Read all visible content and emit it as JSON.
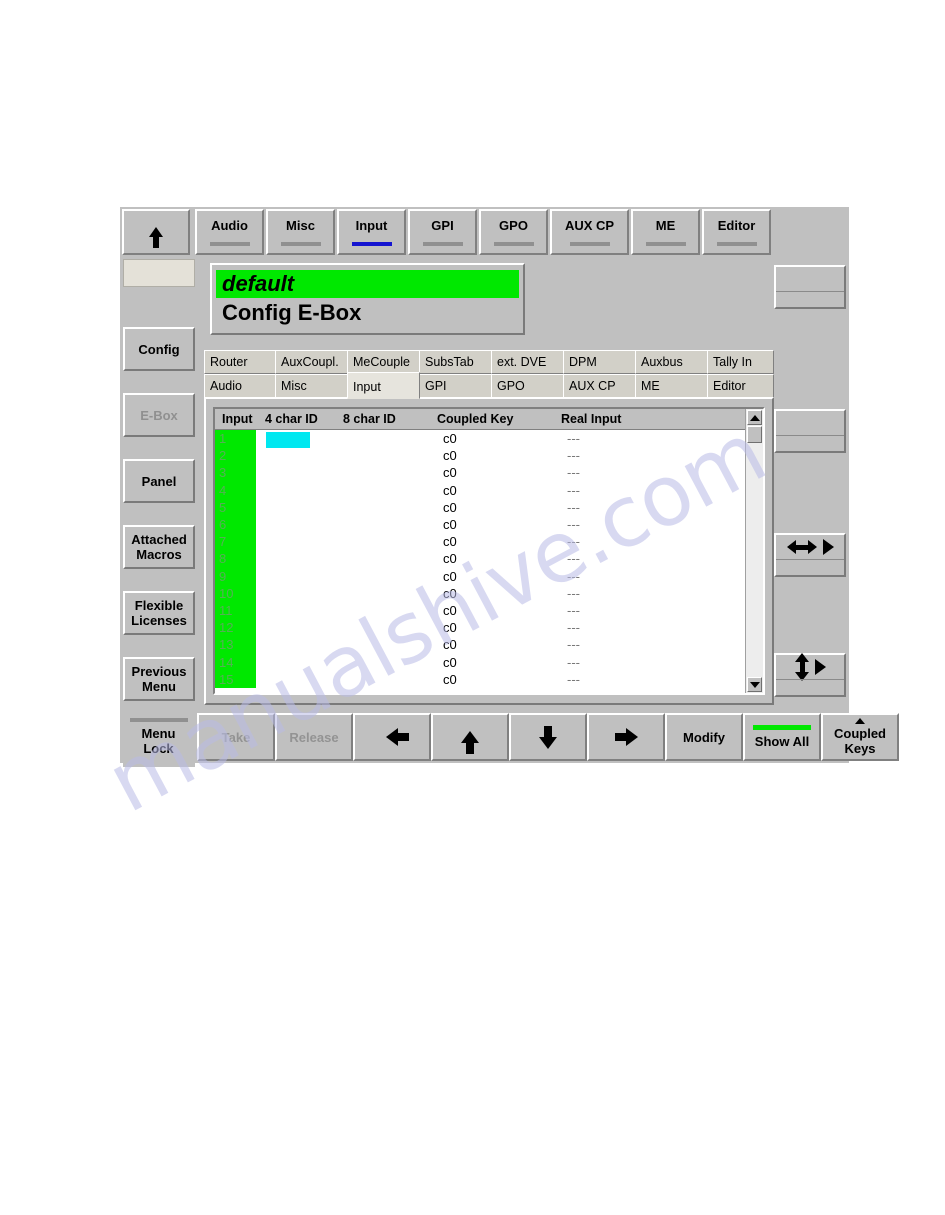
{
  "watermark": {
    "text": "manualshive.com"
  },
  "colors": {
    "panel_face": "#c0c0c0",
    "green": "#00e800",
    "cyan": "#00e8f0",
    "blue_underline": "#1414d0",
    "disabled_text": "#939393"
  },
  "topbar": {
    "back_icon": "arrow-up-icon",
    "tabs": [
      {
        "label": "Audio",
        "selected": false
      },
      {
        "label": "Misc",
        "selected": false
      },
      {
        "label": "Input",
        "selected": true
      },
      {
        "label": "GPI",
        "selected": false
      },
      {
        "label": "GPO",
        "selected": false
      },
      {
        "label": "AUX CP",
        "selected": false
      },
      {
        "label": "ME",
        "selected": false
      },
      {
        "label": "Editor",
        "selected": false
      }
    ]
  },
  "sidebar": {
    "items": [
      {
        "label": "Config",
        "disabled": false
      },
      {
        "label": "E-Box",
        "disabled": true
      },
      {
        "label": "Panel",
        "disabled": false
      },
      {
        "label": "Attached Macros",
        "disabled": false
      },
      {
        "label": "Flexible Licenses",
        "disabled": false
      },
      {
        "label": "Previous Menu",
        "disabled": false
      },
      {
        "label": "Menu Lock",
        "disabled": false
      }
    ]
  },
  "title": {
    "line1": "default",
    "line2": "Config E-Box"
  },
  "subtabs": {
    "row1": [
      {
        "label": "Router",
        "selected": false
      },
      {
        "label": "AuxCoupl.",
        "selected": false
      },
      {
        "label": "MeCouple",
        "selected": false
      },
      {
        "label": "SubsTab",
        "selected": false
      },
      {
        "label": "ext. DVE",
        "selected": false
      },
      {
        "label": "DPM",
        "selected": false
      },
      {
        "label": "Auxbus",
        "selected": false
      },
      {
        "label": "Tally In",
        "selected": false
      }
    ],
    "row2": [
      {
        "label": "Audio",
        "selected": false
      },
      {
        "label": "Misc",
        "selected": false
      },
      {
        "label": "Input",
        "selected": true
      },
      {
        "label": "GPI",
        "selected": false
      },
      {
        "label": "GPO",
        "selected": false
      },
      {
        "label": "AUX CP",
        "selected": false
      },
      {
        "label": "ME",
        "selected": false
      },
      {
        "label": "Editor",
        "selected": false
      }
    ]
  },
  "table": {
    "columns": [
      "Input",
      "4 char ID",
      "8 char ID",
      "Coupled Key",
      "Real Input"
    ],
    "selected_cell": {
      "row": 1,
      "column": "4 char ID"
    },
    "rows": [
      {
        "input": "1",
        "char4": "",
        "char8": "",
        "coupled_key": "c0",
        "real_input": "---"
      },
      {
        "input": "2",
        "char4": "",
        "char8": "",
        "coupled_key": "c0",
        "real_input": "---"
      },
      {
        "input": "3",
        "char4": "",
        "char8": "",
        "coupled_key": "c0",
        "real_input": "---"
      },
      {
        "input": "4",
        "char4": "",
        "char8": "",
        "coupled_key": "c0",
        "real_input": "---"
      },
      {
        "input": "5",
        "char4": "",
        "char8": "",
        "coupled_key": "c0",
        "real_input": "---"
      },
      {
        "input": "6",
        "char4": "",
        "char8": "",
        "coupled_key": "c0",
        "real_input": "---"
      },
      {
        "input": "7",
        "char4": "",
        "char8": "",
        "coupled_key": "c0",
        "real_input": "---"
      },
      {
        "input": "8",
        "char4": "",
        "char8": "",
        "coupled_key": "c0",
        "real_input": "---"
      },
      {
        "input": "9",
        "char4": "",
        "char8": "",
        "coupled_key": "c0",
        "real_input": "---"
      },
      {
        "input": "10",
        "char4": "",
        "char8": "",
        "coupled_key": "c0",
        "real_input": "---"
      },
      {
        "input": "11",
        "char4": "",
        "char8": "",
        "coupled_key": "c0",
        "real_input": "---"
      },
      {
        "input": "12",
        "char4": "",
        "char8": "",
        "coupled_key": "c0",
        "real_input": "---"
      },
      {
        "input": "13",
        "char4": "",
        "char8": "",
        "coupled_key": "c0",
        "real_input": "---"
      },
      {
        "input": "14",
        "char4": "",
        "char8": "",
        "coupled_key": "c0",
        "real_input": "---"
      },
      {
        "input": "15",
        "char4": "",
        "char8": "",
        "coupled_key": "c0",
        "real_input": "---"
      }
    ],
    "scrollbar": {
      "up_icon": "triangle-up-icon",
      "down_icon": "triangle-down-icon"
    }
  },
  "bottombar": {
    "buttons": [
      {
        "label": "Menu Lock",
        "kind": "lock",
        "disabled": false
      },
      {
        "label": "Take",
        "kind": "text",
        "disabled": true
      },
      {
        "label": "Release",
        "kind": "text",
        "disabled": true
      },
      {
        "label": "",
        "kind": "left",
        "disabled": false,
        "icon": "arrow-left-icon"
      },
      {
        "label": "",
        "kind": "up",
        "disabled": false,
        "icon": "arrow-up-icon"
      },
      {
        "label": "",
        "kind": "down",
        "disabled": false,
        "icon": "arrow-down-icon"
      },
      {
        "label": "",
        "kind": "right",
        "disabled": false,
        "icon": "arrow-right-icon"
      },
      {
        "label": "Modify",
        "kind": "text",
        "disabled": false
      },
      {
        "label": "Show All",
        "kind": "green",
        "disabled": false
      },
      {
        "label": "Coupled Keys",
        "kind": "tri",
        "disabled": false
      }
    ]
  },
  "rightbar": {
    "panels": [
      {
        "icon": ""
      },
      {
        "icon": ""
      },
      {
        "icon": "arrows-horizontal-icon"
      },
      {
        "icon": "arrows-vertical-icon"
      }
    ]
  }
}
